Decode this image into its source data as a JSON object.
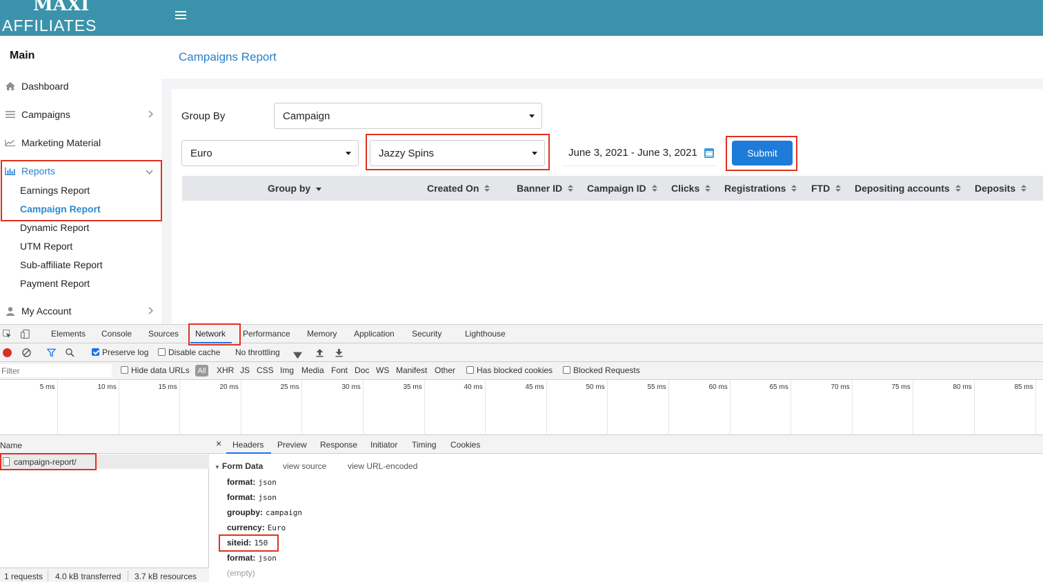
{
  "brand": {
    "logo_top": "MAXI",
    "logo_bottom": "AFFILIATES"
  },
  "sidebar": {
    "title": "Main",
    "items": [
      {
        "label": "Dashboard"
      },
      {
        "label": "Campaigns"
      },
      {
        "label": "Marketing Material"
      },
      {
        "label": "Reports"
      },
      {
        "label": "My Account"
      }
    ],
    "report_subitems": [
      {
        "label": "Earnings Report"
      },
      {
        "label": "Campaign Report"
      },
      {
        "label": "Dynamic Report"
      },
      {
        "label": "UTM Report"
      },
      {
        "label": "Sub-affiliate Report"
      },
      {
        "label": "Payment Report"
      }
    ]
  },
  "page": {
    "title": "Campaigns Report",
    "group_by_label": "Group By",
    "group_by_value": "Campaign",
    "currency_value": "Euro",
    "site_value": "Jazzy Spins",
    "date_range": "June 3, 2021 - June 3, 2021",
    "submit_label": "Submit"
  },
  "table": {
    "columns": [
      {
        "label": "Group by"
      },
      {
        "label": "Created On"
      },
      {
        "label": "Banner ID"
      },
      {
        "label": "Campaign ID"
      },
      {
        "label": "Clicks"
      },
      {
        "label": "Registrations"
      },
      {
        "label": "FTD"
      },
      {
        "label": "Depositing accounts"
      },
      {
        "label": "Deposits"
      }
    ]
  },
  "devtools": {
    "tabs": [
      "Elements",
      "Console",
      "Sources",
      "Network",
      "Performance",
      "Memory",
      "Application",
      "Security",
      "Lighthouse"
    ],
    "active_tab": "Network",
    "toolbar": {
      "preserve_log": "Preserve log",
      "disable_cache": "Disable cache",
      "throttling": "No throttling"
    },
    "filter": {
      "placeholder": "Filter",
      "hide_data_urls": "Hide data URLs",
      "all": "All",
      "types": [
        "XHR",
        "JS",
        "CSS",
        "Img",
        "Media",
        "Font",
        "Doc",
        "WS",
        "Manifest",
        "Other"
      ],
      "has_blocked_cookies": "Has blocked cookies",
      "blocked_requests": "Blocked Requests"
    },
    "timeline_ticks": [
      "5 ms",
      "10 ms",
      "15 ms",
      "20 ms",
      "25 ms",
      "30 ms",
      "35 ms",
      "40 ms",
      "45 ms",
      "50 ms",
      "55 ms",
      "60 ms",
      "65 ms",
      "70 ms",
      "75 ms",
      "80 ms",
      "85 ms"
    ],
    "name_header": "Name",
    "request_name": "campaign-report/",
    "status": {
      "requests": "1 requests",
      "transferred": "4.0 kB transferred",
      "resources": "3.7 kB resources"
    },
    "detail_close": "×",
    "detail_tabs": [
      "Headers",
      "Preview",
      "Response",
      "Initiator",
      "Timing",
      "Cookies"
    ],
    "form_data": {
      "title": "Form Data",
      "view_source": "view source",
      "view_url_encoded": "view URL-encoded",
      "rows": [
        {
          "key": "format:",
          "value": "json"
        },
        {
          "key": "format:",
          "value": "json"
        },
        {
          "key": "groupby:",
          "value": "campaign"
        },
        {
          "key": "currency:",
          "value": "Euro"
        },
        {
          "key": "siteid:",
          "value": "150"
        },
        {
          "key": "format:",
          "value": "json"
        }
      ],
      "empty": "(empty)"
    }
  }
}
